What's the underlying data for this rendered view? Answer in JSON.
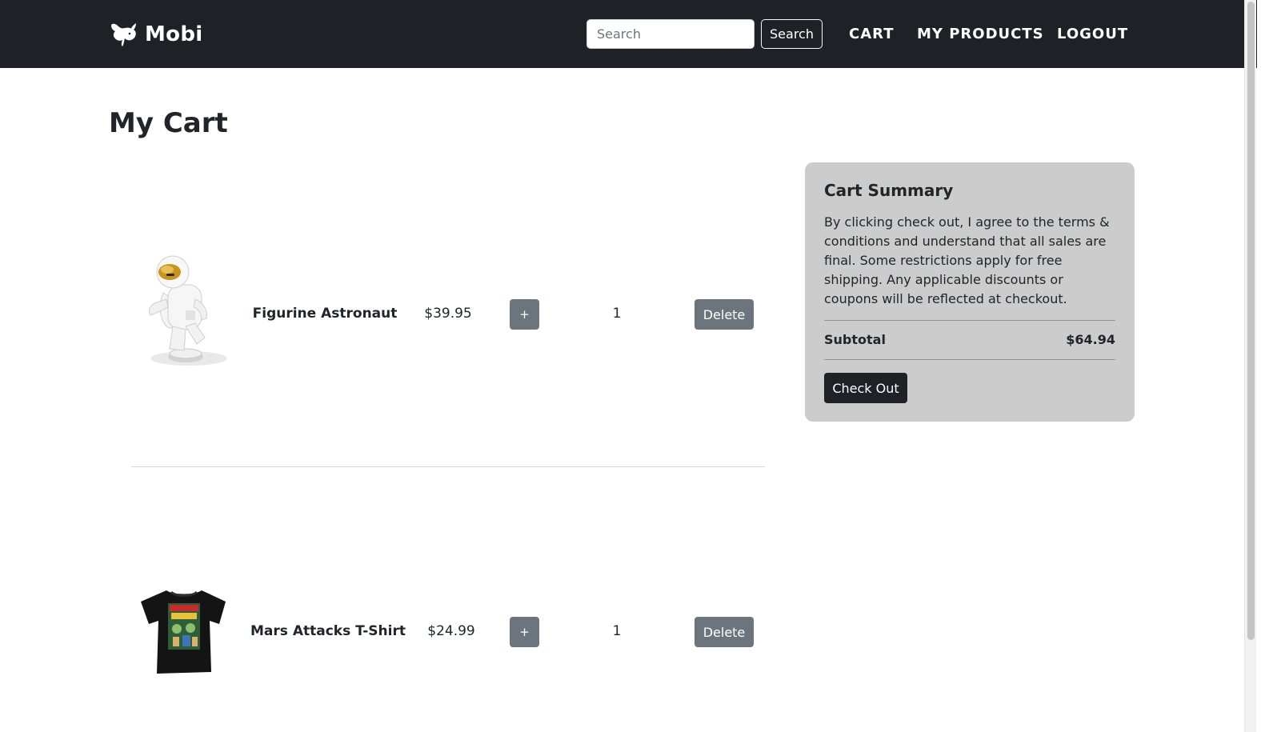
{
  "brand": {
    "name": "Mobi",
    "logo_icon": "whale-icon"
  },
  "search": {
    "placeholder": "Search",
    "button_label": "Search"
  },
  "nav": {
    "cart": "CART",
    "my_products": "MY PRODUCTS",
    "logout": "LOGOUT"
  },
  "page": {
    "title": "My Cart"
  },
  "cart": {
    "items": [
      {
        "name": "Figurine Astronaut",
        "price": "$39.95",
        "add_label": "+",
        "quantity": "1",
        "delete_label": "Delete",
        "image": "astronaut-figurine-image"
      },
      {
        "name": "Mars Attacks T-Shirt",
        "price": "$24.99",
        "add_label": "+",
        "quantity": "1",
        "delete_label": "Delete",
        "image": "tshirt-image"
      }
    ]
  },
  "summary": {
    "title": "Cart Summary",
    "terms": "By clicking check out, I agree to the terms & conditions and understand that all sales are final. Some restrictions apply for free shipping. Any applicable discounts or coupons will be reflected at checkout.",
    "subtotal_label": "Subtotal",
    "subtotal_value": "$64.94",
    "checkout_label": "Check Out"
  },
  "colors": {
    "navbar": "#1e2226",
    "button_secondary": "#6c757d",
    "summary_bg": "#cccccc"
  }
}
